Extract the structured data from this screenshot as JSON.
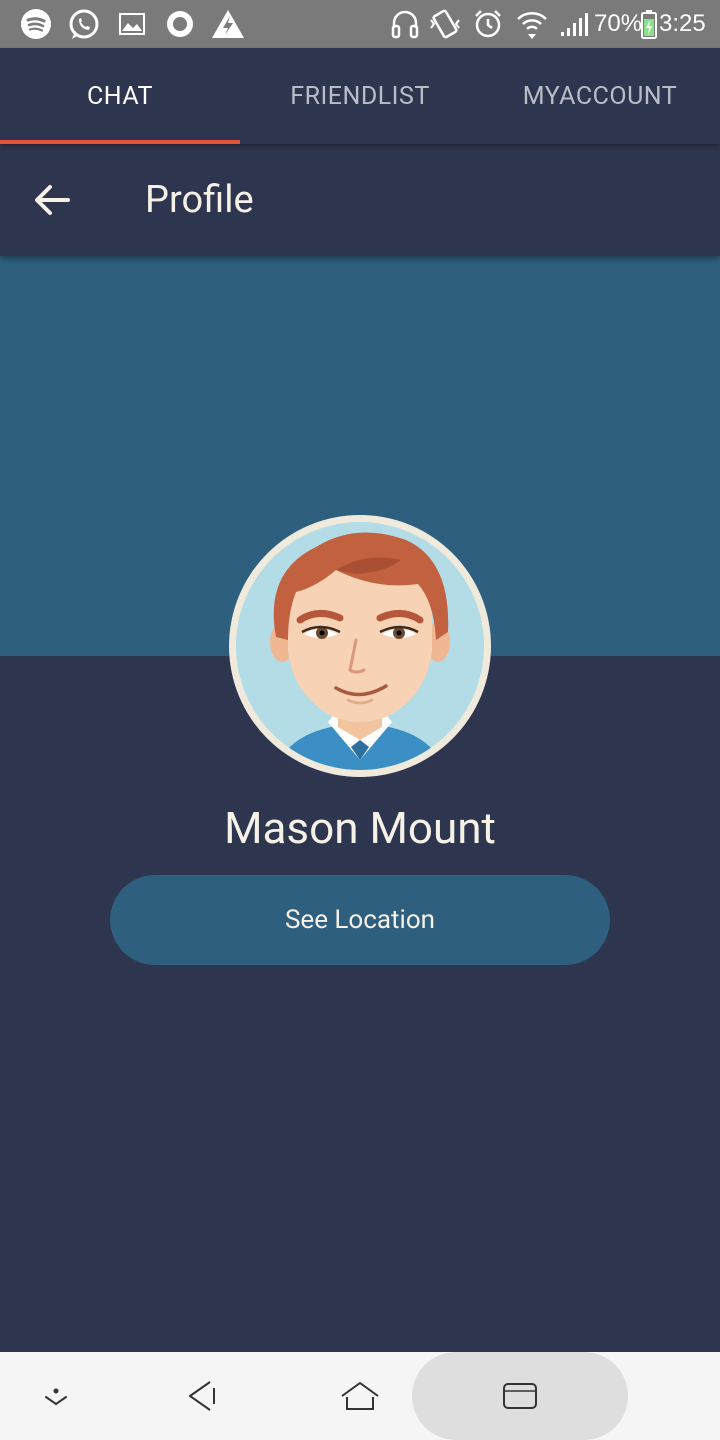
{
  "status_bar": {
    "battery_text": "70%",
    "time_text": "3:25",
    "icons": [
      "spotify-icon",
      "whatsapp-icon",
      "gallery-icon",
      "record-icon",
      "warning-icon",
      "headphones-icon",
      "vibrate-icon",
      "alarm-icon",
      "wifi-icon",
      "signal-icon",
      "battery-charging-icon"
    ]
  },
  "tabs": {
    "items": [
      {
        "label": "CHAT",
        "active": true
      },
      {
        "label": "FRIENDLIST",
        "active": false
      },
      {
        "label": "MYACCOUNT",
        "active": false
      }
    ]
  },
  "toolbar": {
    "title": "Profile",
    "back_icon": "arrow-left-icon"
  },
  "profile": {
    "name": "Mason Mount",
    "button_label": "See Location",
    "avatar_icon": "cartoon-man-avatar"
  },
  "nav_bar": {
    "icons": [
      "dropdown-icon",
      "back-icon",
      "home-icon",
      "recents-icon"
    ]
  },
  "colors": {
    "background": "#2e354f",
    "cover": "#2e5f7e",
    "tab_indicator": "#e3543a",
    "text": "#f5f1e6",
    "status_bar": "#7a7a7a"
  }
}
